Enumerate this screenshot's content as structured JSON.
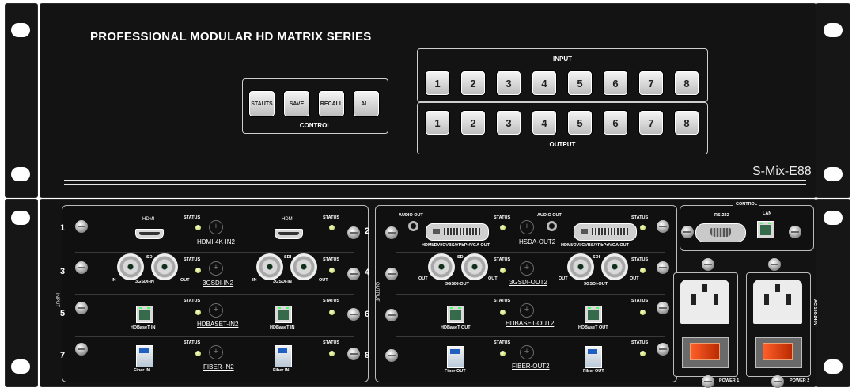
{
  "top_unit": {
    "title": "PROFESSIONAL MODULAR HD MATRIX SERIES",
    "model": "S-Mix-E88",
    "control": {
      "label": "CONTROL",
      "buttons": [
        "STAUTS",
        "SAVE",
        "RECALL",
        "ALL"
      ]
    },
    "input": {
      "label": "INPUT",
      "buttons": [
        "1",
        "2",
        "3",
        "4",
        "5",
        "6",
        "7",
        "8"
      ]
    },
    "output": {
      "label": "OUTPUT",
      "buttons": [
        "1",
        "2",
        "3",
        "4",
        "5",
        "6",
        "7",
        "8"
      ]
    }
  },
  "rear_unit": {
    "input_side_label": "INPUT",
    "output_side_label": "OUTPUT",
    "status_label": "STATUS",
    "slot_numbers": [
      "1",
      "2",
      "3",
      "4",
      "5",
      "6",
      "7",
      "8"
    ],
    "input_cards": [
      {
        "name": "HDMI-4K-IN2",
        "port_labels": [
          "HDMI",
          "HDMI"
        ]
      },
      {
        "name": "3GSDI-IN2",
        "port_labels": [
          "SDI",
          "SDI"
        ],
        "sub_labels": [
          "IN",
          "3GSDI-IN",
          "OUT",
          "IN",
          "3GSDI-IN",
          "OUT"
        ]
      },
      {
        "name": "HDBASET-IN2",
        "port_labels": [
          "HDBaseT IN",
          "HDBaseT IN"
        ]
      },
      {
        "name": "FIBER-IN2",
        "port_labels": [
          "Fiber IN",
          "Fiber IN"
        ]
      }
    ],
    "output_cards": [
      {
        "name": "HSDA-OUT2",
        "port_labels": [
          "AUDIO OUT",
          "AUDIO OUT",
          "HDMI/DVI/CVBS/YPbPr/VGA OUT",
          "HDMI/DVI/CVBS/YPbPr/VGA OUT"
        ]
      },
      {
        "name": "3GSDI-OUT2",
        "port_labels": [
          "SDI",
          "SDI"
        ],
        "sub_labels": [
          "OUT",
          "3GSDI-OUT",
          "OUT",
          "OUT",
          "3GSDI-OUT",
          "OUT"
        ]
      },
      {
        "name": "HDBASET-OUT2",
        "port_labels": [
          "HDBaseT OUT",
          "HDBaseT OUT"
        ]
      },
      {
        "name": "FIBER-OUT2",
        "port_labels": [
          "Fiber OUT",
          "Fiber OUT"
        ]
      }
    ],
    "control": {
      "label": "CONTROL",
      "rs232": "RS-232",
      "lan": "LAN"
    },
    "power": {
      "labels": [
        "POWER 1",
        "POWER 2"
      ],
      "voltage": "AC 100-240V"
    }
  }
}
